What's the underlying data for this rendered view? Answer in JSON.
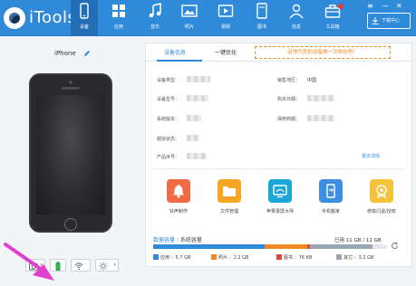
{
  "app": {
    "name": "iTools"
  },
  "nav": [
    {
      "label": "设备",
      "icon": "phone-icon",
      "active": true
    },
    {
      "label": "应用",
      "icon": "apps-grid-icon",
      "active": false
    },
    {
      "label": "音乐",
      "icon": "music-note-icon",
      "active": false
    },
    {
      "label": "照片",
      "icon": "photo-icon",
      "active": false
    },
    {
      "label": "视频",
      "icon": "video-icon",
      "active": false
    },
    {
      "label": "图书",
      "icon": "book-icon",
      "active": false
    },
    {
      "label": "信息",
      "icon": "user-icon",
      "active": false
    },
    {
      "label": "工具箱",
      "icon": "toolbox-icon",
      "active": false
    }
  ],
  "download": {
    "label": "下载中心"
  },
  "device": {
    "name": "iPhone"
  },
  "tabs": {
    "info": "设备信息",
    "optimize": "一键优化"
  },
  "banner": {
    "text": "赶快为您的设备做一次体检吧！"
  },
  "info": {
    "left": [
      {
        "label": "设备类型："
      },
      {
        "label": "设备型号："
      },
      {
        "label": "系统版本："
      },
      {
        "label": "越狱状态："
      },
      {
        "label": "产品序号："
      }
    ],
    "right": [
      {
        "label": "销售地区：",
        "value": "中国"
      },
      {
        "label": "购买日期："
      },
      {
        "label": "保修到期："
      }
    ],
    "more": "更多详情"
  },
  "tiles": [
    {
      "label": "铃声制作",
      "icon": "bell-icon",
      "color": "#f06a43"
    },
    {
      "label": "文件管理",
      "icon": "folder-icon",
      "color": "#f5a623"
    },
    {
      "label": "苹果录屏大师",
      "icon": "screen-record-icon",
      "color": "#1aa7d8"
    },
    {
      "label": "手机搬家",
      "icon": "phone-transfer-icon",
      "color": "#3f8fe0"
    },
    {
      "label": "修复闪退/授权",
      "icon": "repair-badge-icon",
      "color": "#f5c23b"
    }
  ],
  "storage": {
    "tab_data": "数据容量",
    "tab_system": "系统容量",
    "summary": "已用 11 GB / 12 GB",
    "legend": [
      {
        "label": "应用 ：5.7 GB",
        "color": "#2f8ad9",
        "fraction": 0.475
      },
      {
        "label": "照片 ：2.2 GB",
        "color": "#f08a24",
        "fraction": 0.183
      },
      {
        "label": "图书 ：76 KB",
        "color": "#e2483b",
        "fraction": 0.01
      },
      {
        "label": "其它 ：3.2 GB",
        "color": "#9aa6b3",
        "fraction": 0.267
      }
    ]
  }
}
